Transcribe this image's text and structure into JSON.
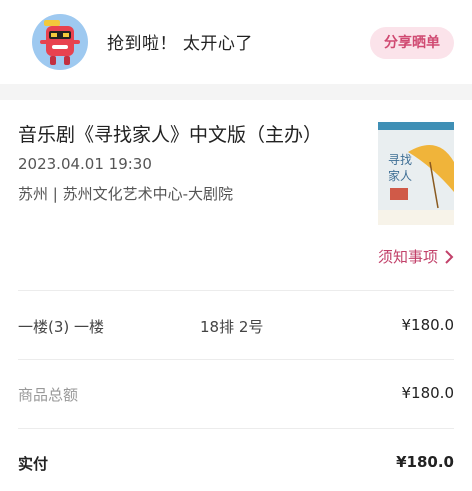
{
  "header": {
    "status_text": "抢到啦！ 太开心了",
    "share_label": "分享晒单",
    "avatar_colors": {
      "bg": "#9ec9f0",
      "body": "#e8424f",
      "accent": "#f3c93c"
    }
  },
  "event": {
    "title": "音乐剧《寻找家人》中文版（主办）",
    "datetime": "2023.04.01 19:30",
    "venue": "苏州 | 苏州文化艺术中心-大剧院",
    "poster": {
      "title": "寻找家人",
      "bg": "#e9eef0",
      "accent": "#f0b43a"
    },
    "notice_label": "须知事项"
  },
  "ticket": {
    "area": "一楼(3) 一楼",
    "seat": "18排 2号",
    "price": "¥180.0"
  },
  "summary": {
    "goods_label": "商品总额",
    "goods_amount": "¥180.0",
    "paid_label": "实付",
    "paid_amount": "¥180.0"
  },
  "colors": {
    "accent": "#c2416a",
    "share_bg": "#fbe3ea",
    "section_gap": "#f4f4f4"
  }
}
